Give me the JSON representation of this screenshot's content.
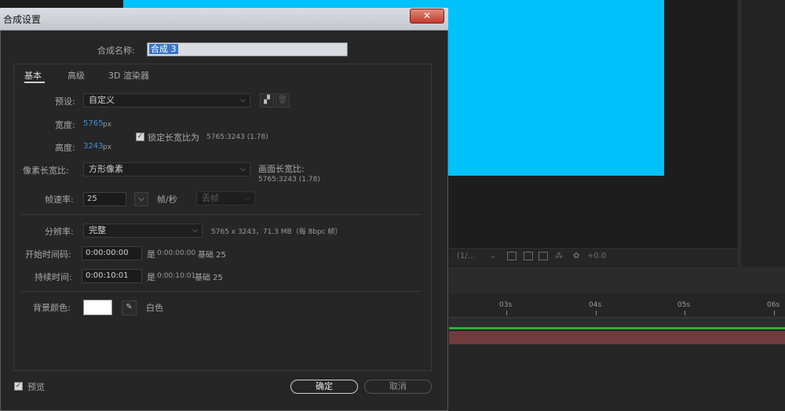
{
  "dialog": {
    "title": "合成设置",
    "close_label": "✕",
    "comp_name_label": "合成名称:",
    "comp_name_value": "合成 3"
  },
  "tabs": [
    {
      "label": "基本"
    },
    {
      "label": "高级"
    },
    {
      "label": "3D 渲染器"
    }
  ],
  "basic": {
    "preset_label": "预设:",
    "preset_value": "自定义",
    "width_label": "宽度:",
    "width_value": "5765",
    "width_unit": "px",
    "height_label": "高度:",
    "height_value": "3243",
    "height_unit": "px",
    "lock_aspect_label": "锁定长宽比为",
    "lock_aspect_value": "5765:3243 (1.78)",
    "lock_aspect_checked": true,
    "pixel_aspect_label": "像素长宽比:",
    "pixel_aspect_value": "方形像素",
    "frame_aspect_label": "画面长宽比:",
    "frame_aspect_value": "5765:3243 (1.78)",
    "frame_rate_label": "帧速率:",
    "frame_rate_value": "25",
    "frame_rate_unit": "帧/秒",
    "drop_frame_value": "丢帧",
    "resolution_label": "分辨率:",
    "resolution_value": "完整",
    "resolution_info": "5765 x 3243，71.3 MB（每 8bpc 帧）",
    "start_timecode_label": "开始时间码:",
    "start_timecode_value": "0:00:00:00",
    "start_timecode_is": "是",
    "start_timecode_info": "0:00:00:00",
    "start_timecode_base": "基础 25",
    "duration_label": "持续时间:",
    "duration_value": "0:00:10:01",
    "duration_is": "是",
    "duration_info": "0:00:10:01",
    "duration_base": "基础 25",
    "bg_color_label": "背景颜色:",
    "bg_color_name": "白色",
    "bg_color_hex": "#ffffff"
  },
  "footer": {
    "preview_label": "预览",
    "preview_checked": true,
    "ok_label": "确定",
    "cancel_label": "取消"
  },
  "workspace": {
    "canvas_color": "#00c2fa",
    "viewer_zoom_value": "(1/...",
    "viewer_exposure_value": "+0.0",
    "ruler_ticks": [
      "03s",
      "04s",
      "05s",
      "06s"
    ]
  }
}
